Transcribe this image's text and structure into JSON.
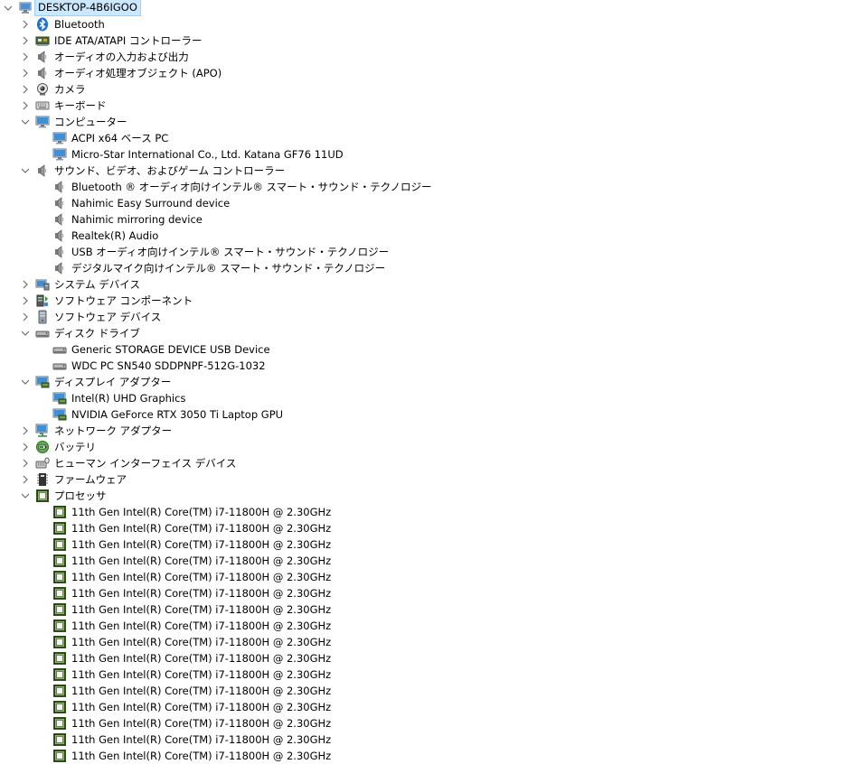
{
  "root": {
    "label": "DESKTOP-4B6IGOO",
    "expanded": true
  },
  "nodes": [
    {
      "id": "bluetooth",
      "label": "Bluetooth",
      "icon": "bluetooth-icon",
      "expanded": false,
      "children": []
    },
    {
      "id": "ide",
      "label": "IDE ATA/ATAPI コントローラー",
      "icon": "ide-controller-icon",
      "expanded": false,
      "children": []
    },
    {
      "id": "audio-io",
      "label": "オーディオの入力および出力",
      "icon": "speaker-icon",
      "expanded": false,
      "children": []
    },
    {
      "id": "apo",
      "label": "オーディオ処理オブジェクト (APO)",
      "icon": "speaker-icon",
      "expanded": false,
      "children": []
    },
    {
      "id": "camera",
      "label": "カメラ",
      "icon": "webcam-icon",
      "expanded": false,
      "children": []
    },
    {
      "id": "keyboard",
      "label": "キーボード",
      "icon": "keyboard-icon",
      "expanded": false,
      "children": []
    },
    {
      "id": "computer",
      "label": "コンピューター",
      "icon": "monitor-icon",
      "expanded": true,
      "children": [
        {
          "label": "ACPI x64 ベース PC",
          "icon": "monitor-icon"
        },
        {
          "label": "Micro-Star International Co., Ltd. Katana GF76 11UD",
          "icon": "monitor-icon"
        }
      ]
    },
    {
      "id": "sound",
      "label": "サウンド、ビデオ、およびゲーム コントローラー",
      "icon": "speaker-icon",
      "expanded": true,
      "children": [
        {
          "label": "Bluetooth ® オーディオ向けインテル® スマート・サウンド・テクノロジー",
          "icon": "speaker-icon"
        },
        {
          "label": "Nahimic Easy Surround device",
          "icon": "speaker-icon"
        },
        {
          "label": "Nahimic mirroring device",
          "icon": "speaker-icon"
        },
        {
          "label": "Realtek(R) Audio",
          "icon": "speaker-icon"
        },
        {
          "label": "USB オーディオ向けインテル® スマート・サウンド・テクノロジー",
          "icon": "speaker-icon"
        },
        {
          "label": "デジタルマイク向けインテル® スマート・サウンド・テクノロジー",
          "icon": "speaker-icon"
        }
      ]
    },
    {
      "id": "system",
      "label": "システム デバイス",
      "icon": "system-devices-icon",
      "expanded": false,
      "children": []
    },
    {
      "id": "sw-component",
      "label": "ソフトウェア コンポーネント",
      "icon": "software-component-icon",
      "expanded": false,
      "children": []
    },
    {
      "id": "sw-device",
      "label": "ソフトウェア デバイス",
      "icon": "software-device-icon",
      "expanded": false,
      "children": []
    },
    {
      "id": "disk",
      "label": "ディスク ドライブ",
      "icon": "disk-drive-icon",
      "expanded": true,
      "children": [
        {
          "label": "Generic STORAGE DEVICE USB Device",
          "icon": "disk-drive-icon"
        },
        {
          "label": "WDC PC SN540 SDDPNPF-512G-1032",
          "icon": "disk-drive-icon"
        }
      ]
    },
    {
      "id": "display",
      "label": "ディスプレイ アダプター",
      "icon": "display-adapter-icon",
      "expanded": true,
      "children": [
        {
          "label": "Intel(R) UHD Graphics",
          "icon": "display-adapter-icon"
        },
        {
          "label": "NVIDIA GeForce RTX 3050 Ti Laptop GPU",
          "icon": "display-adapter-icon"
        }
      ]
    },
    {
      "id": "network",
      "label": "ネットワーク アダプター",
      "icon": "network-icon",
      "expanded": false,
      "children": []
    },
    {
      "id": "battery",
      "label": "バッテリ",
      "icon": "battery-icon",
      "expanded": false,
      "children": []
    },
    {
      "id": "hid",
      "label": "ヒューマン インターフェイス デバイス",
      "icon": "hid-icon",
      "expanded": false,
      "children": []
    },
    {
      "id": "firmware",
      "label": "ファームウェア",
      "icon": "firmware-icon",
      "expanded": false,
      "children": []
    },
    {
      "id": "processor",
      "label": "プロセッサ",
      "icon": "processor-icon",
      "expanded": true,
      "children": [
        {
          "label": "11th Gen Intel(R) Core(TM) i7-11800H @ 2.30GHz",
          "icon": "processor-icon"
        },
        {
          "label": "11th Gen Intel(R) Core(TM) i7-11800H @ 2.30GHz",
          "icon": "processor-icon"
        },
        {
          "label": "11th Gen Intel(R) Core(TM) i7-11800H @ 2.30GHz",
          "icon": "processor-icon"
        },
        {
          "label": "11th Gen Intel(R) Core(TM) i7-11800H @ 2.30GHz",
          "icon": "processor-icon"
        },
        {
          "label": "11th Gen Intel(R) Core(TM) i7-11800H @ 2.30GHz",
          "icon": "processor-icon"
        },
        {
          "label": "11th Gen Intel(R) Core(TM) i7-11800H @ 2.30GHz",
          "icon": "processor-icon"
        },
        {
          "label": "11th Gen Intel(R) Core(TM) i7-11800H @ 2.30GHz",
          "icon": "processor-icon"
        },
        {
          "label": "11th Gen Intel(R) Core(TM) i7-11800H @ 2.30GHz",
          "icon": "processor-icon"
        },
        {
          "label": "11th Gen Intel(R) Core(TM) i7-11800H @ 2.30GHz",
          "icon": "processor-icon"
        },
        {
          "label": "11th Gen Intel(R) Core(TM) i7-11800H @ 2.30GHz",
          "icon": "processor-icon"
        },
        {
          "label": "11th Gen Intel(R) Core(TM) i7-11800H @ 2.30GHz",
          "icon": "processor-icon"
        },
        {
          "label": "11th Gen Intel(R) Core(TM) i7-11800H @ 2.30GHz",
          "icon": "processor-icon"
        },
        {
          "label": "11th Gen Intel(R) Core(TM) i7-11800H @ 2.30GHz",
          "icon": "processor-icon"
        },
        {
          "label": "11th Gen Intel(R) Core(TM) i7-11800H @ 2.30GHz",
          "icon": "processor-icon"
        },
        {
          "label": "11th Gen Intel(R) Core(TM) i7-11800H @ 2.30GHz",
          "icon": "processor-icon"
        },
        {
          "label": "11th Gen Intel(R) Core(TM) i7-11800H @ 2.30GHz",
          "icon": "processor-icon"
        }
      ]
    }
  ],
  "colors": {
    "selection_bg": "#cce8ff",
    "selection_border": "#99d1ff",
    "chevron": "#6d6d6d",
    "text": "#000000"
  }
}
